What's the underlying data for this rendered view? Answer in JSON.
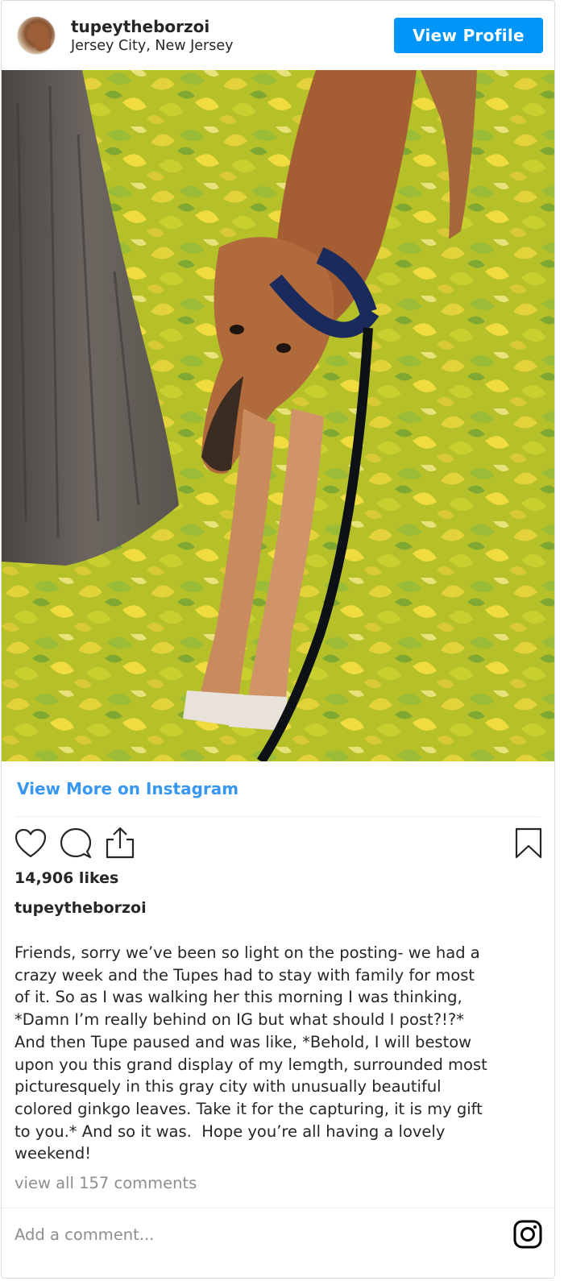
{
  "header": {
    "username": "tupeytheborzoi",
    "location": "Jersey City, New Jersey",
    "view_profile_label": "View Profile",
    "avatar_icon": "profile-photo"
  },
  "post": {
    "image_description_icon": "borzoi-dog-photo",
    "view_more_label": "View More on Instagram",
    "likes": "14,906 likes",
    "caption_username": "tupeytheborzoi",
    "caption": "Friends, sorry we’ve been so light on the posting- we had a\ncrazy week and the Tupes had to stay with family for most\nof it. So as I was walking her this morning I was thinking,\n*Damn I’m really behind on IG but what should I post?!?*\nAnd then Tupe paused and was like, *Behold, I will bestow\nupon you this grand display of my lemgth, surrounded most\npicturesquely in this gray city with unusually beautiful\ncolored ginkgo leaves. Take it for the capturing, it is my gift\nto you.* And so it was.  Hope you’re all having a lovely\nweekend!",
    "comments_link": "view all 157 comments",
    "add_comment_placeholder": "Add a comment..."
  },
  "actions": {
    "like_icon": "heart-icon",
    "comment_icon": "comment-icon",
    "share_icon": "share-icon",
    "save_icon": "bookmark-icon",
    "instagram_icon": "instagram-logo-icon"
  },
  "colors": {
    "brand_blue": "#0095f6",
    "link_blue": "#3897f0",
    "text": "#262626",
    "muted": "#8e8e8e"
  }
}
